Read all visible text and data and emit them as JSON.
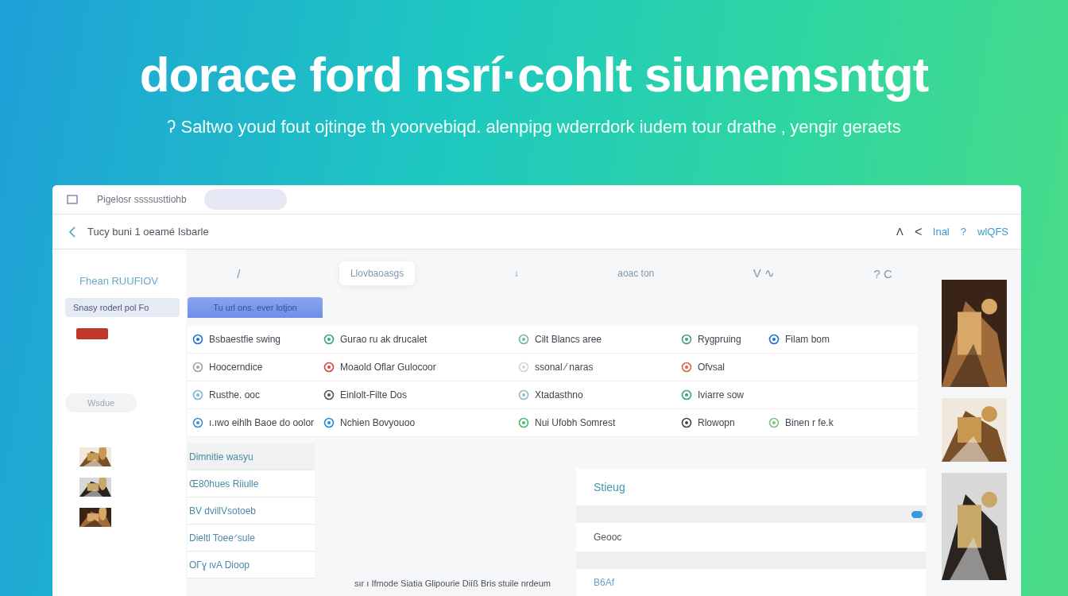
{
  "headline": "dorace ford nsrí·cohlt siunemsntgt",
  "subtitle": "ʔ Saltwo youd fout ojtinge th yoorvebiqd. alenpipg wderrdork iudem tour drathe ‚ yengir geraets",
  "window": {
    "title": "Pigelosr ssssusttiohb",
    "address": "Tucy buni 1 oeamé Isbarle",
    "toolbar_items": [
      "Λ",
      "ᐸ",
      "Inal",
      "?",
      "wlQFS"
    ]
  },
  "sidebar": {
    "heading": "Fhean RUUFIOV",
    "items": [
      {
        "label": "Snasy roderl pol Fo",
        "selected": true
      },
      {
        "label": "Wsdue",
        "selected": false
      }
    ]
  },
  "header": {
    "items": [
      "/",
      "Llovbaoasgs",
      "↓",
      "aoac ton",
      "V ∿",
      "? C"
    ]
  },
  "tab": {
    "label": "Tu url ons. ever lotjon",
    "selected": true
  },
  "grid": {
    "rows": [
      {
        "cells": [
          {
            "text": "Bsbaestfie swing",
            "color": "#1e6fd6"
          },
          {
            "text": "Gurao  ru  ak drucalet",
            "color": "#3aa57a"
          },
          {
            "text": "Cilt Blancs aree",
            "color": "#6fb8a0"
          },
          {
            "text": "Rygpruing",
            "color": "#3aa57a"
          },
          {
            "text": "Filam bom",
            "color": "#1e6fd6"
          }
        ]
      },
      {
        "cells": [
          {
            "text": "Hoocerndice",
            "color": "#9aa3ad"
          },
          {
            "text": "Moaold Oflar Gulocoor",
            "color": "#d8443a"
          },
          {
            "text": "ssonal ⁄ naras",
            "color": "#d0d4d8"
          },
          {
            "text": "Ofvsal",
            "color": "#e0603c"
          }
        ]
      },
      {
        "cells": [
          {
            "text": "Rusthe. ooc",
            "color": "#7ab8d8"
          },
          {
            "text": "Einlolt-Filte Dos",
            "color": "#555555"
          },
          {
            "text": "Xtadasthno",
            "color": "#8fbcc8"
          },
          {
            "text": "Iviarre sow",
            "color": "#3aa57a"
          }
        ]
      },
      {
        "cells": [
          {
            "text": "ı.ıwo eihlh Baoe do oolor",
            "color": "#3a8fd0"
          },
          {
            "text": "Nchien Bovyouoo",
            "color": "#1e8fd6"
          },
          {
            "text": "Nui Ufobh Somrest",
            "color": "#4cb86a"
          },
          {
            "text": "Rlowopn",
            "color": "#444444"
          },
          {
            "text": "Binen r fe.k",
            "color": "#7cc47a"
          }
        ]
      }
    ]
  },
  "list": [
    {
      "label": "Dimnitie wasyu",
      "selected": true
    },
    {
      "label": "Œ80hues Riiulle",
      "selected": false
    },
    {
      "label": "BV dvillVsotoeb",
      "selected": false
    },
    {
      "label": "Dieltl Toeeᐟsule",
      "selected": false
    },
    {
      "label": "OΓɣ ιvA Dioop",
      "selected": false
    }
  ],
  "note": "sır ı Ifmode Siatia Glipourie Diíß Bris stuile nrdeum",
  "panel": {
    "rows": [
      {
        "text": "Stieug",
        "kind": "title"
      },
      {
        "kind": "badge"
      },
      {
        "text": "Geooc",
        "kind": "plain"
      },
      {
        "kind": "blank"
      },
      {
        "text": "B6Af",
        "kind": "link"
      }
    ]
  }
}
